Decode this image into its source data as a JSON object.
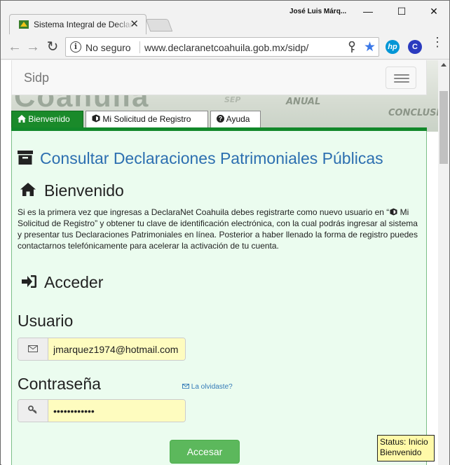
{
  "browser": {
    "tab_title": "Sistema Integral de Declaraciones",
    "profile_name": "José Luis Márq...",
    "security_label": "No seguro",
    "url": "www.declaranetcoahuila.gob.mx/sidp/",
    "window_controls": {
      "minimize": "—",
      "maximize": "☐",
      "close": "✕"
    },
    "extensions": [
      {
        "icon": "hp-icon",
        "label": "hp",
        "color": "#0096d6"
      },
      {
        "icon": "c-icon",
        "label": "C",
        "color": "#2b3bbf"
      }
    ]
  },
  "banner": {
    "big_text": "Coahuila",
    "words": [
      "ANUAL",
      "CONCLUSIO",
      "SEP"
    ]
  },
  "navbar": {
    "brand": "Sidp"
  },
  "tabs": [
    {
      "label": "Bienvenido",
      "icon": "home-icon",
      "active": true
    },
    {
      "label": "Mi Solicitud de Registro",
      "icon": "cube-icon",
      "active": false
    },
    {
      "label": "Ayuda",
      "icon": "question-icon",
      "active": false
    }
  ],
  "main": {
    "title": "Consultar Declaraciones Patrimoniales Públicas",
    "welcome_heading": "Bienvenido",
    "intro_part1": "Si es la primera vez que ingresas a DeclaraNet Coahuila debes registrarte como nuevo usuario en “",
    "intro_link": " Mi Solicitud de Registro",
    "intro_part2": "” y obtener tu clave de identificación electrónica, con la cual podrás ingresar al sistema y presentar tus Declaraciones Patrimoniales en línea. Posterior a haber llenado la forma de registro puedes contactarnos telefónicamente para acelerar la activación de tu cuenta.",
    "login_heading": "Acceder",
    "usuario_label": "Usuario",
    "usuario_value": "jmarquez1974@hotmail.com",
    "password_label": "Contraseña",
    "password_value": "••••••••••••",
    "forgot_link": "La olvidaste?",
    "submit_label": "Accesar"
  },
  "status": {
    "line1": "Status: Inicio",
    "line2": "Bienvenido"
  },
  "colors": {
    "accent_green": "#12882a",
    "title_blue": "#2c6fb0",
    "content_bg": "#ebfcef",
    "field_bg": "#fefcbf",
    "button_green": "#5cb85c"
  }
}
